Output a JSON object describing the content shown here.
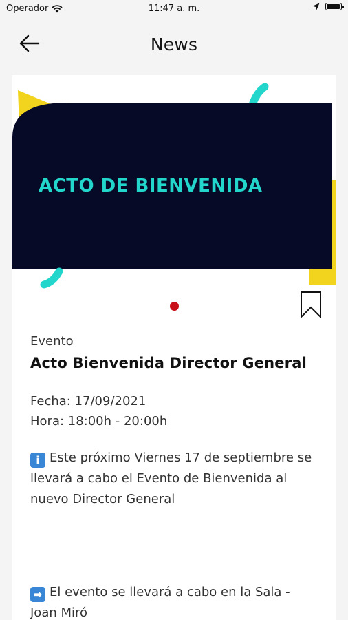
{
  "status_bar": {
    "carrier": "Operador",
    "time": "11:47 a. m.",
    "icons": [
      "wifi-icon",
      "location-arrow-icon",
      "battery-icon"
    ]
  },
  "header": {
    "back_icon": "arrow-left-icon",
    "title": "News"
  },
  "banner": {
    "title": "ACTO DE BIENVENIDA",
    "colors": {
      "dark": "#070a26",
      "cyan": "#22d6cc",
      "yellow": "#f2d31e"
    }
  },
  "carousel": {
    "active_dot_color": "#c8101a"
  },
  "article": {
    "bookmark_icon": "bookmark-icon",
    "category": "Evento",
    "headline": "Acto Bienvenida Director General",
    "date": "Fecha: 17/09/2021",
    "time": "Hora: 18:00h - 20:00h",
    "paragraphs": [
      {
        "icon": "info-icon",
        "glyph": "i",
        "text": "Este próximo Viernes 17 de septiembre se llevará a cabo el Evento de Bienvenida al nuevo Director General"
      },
      {
        "icon": "right-arrow-icon",
        "glyph": "➡",
        "text": "El evento se llevará a cabo en la Sala - Joan Miró"
      }
    ]
  }
}
